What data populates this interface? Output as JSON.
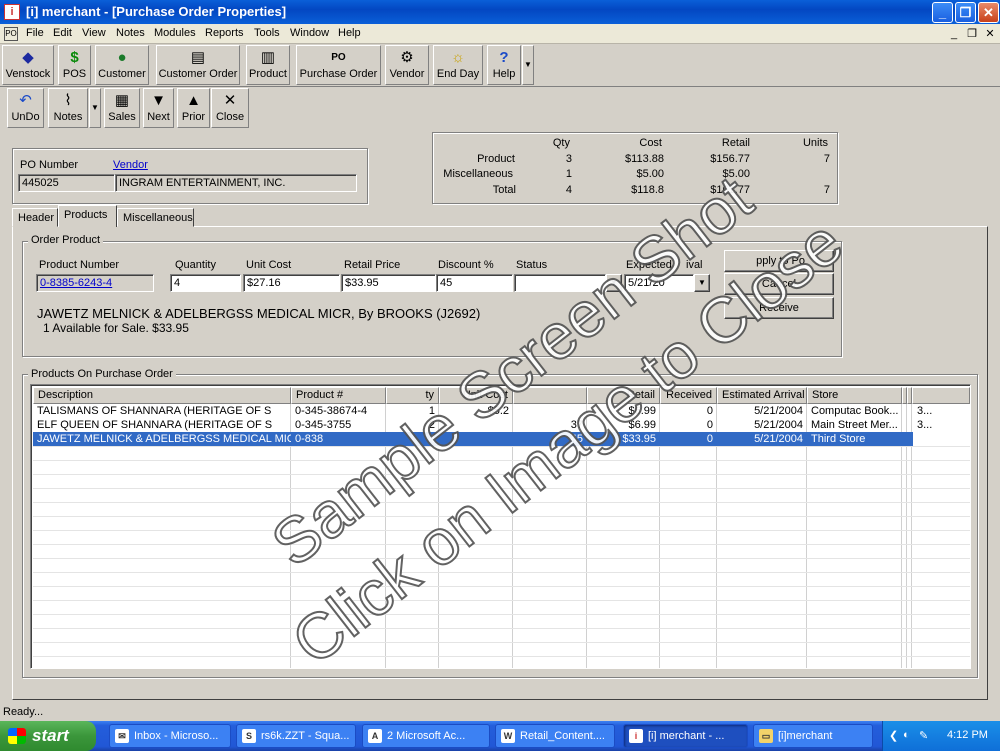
{
  "window": {
    "title": "[i] merchant - [Purchase Order Properties]",
    "app_icon": "i"
  },
  "menu": [
    "File",
    "Edit",
    "View",
    "Notes",
    "Modules",
    "Reports",
    "Tools",
    "Window",
    "Help"
  ],
  "main_toolbar": [
    {
      "label": "Venstock",
      "icon": "◆"
    },
    {
      "label": "POS",
      "icon": "$"
    },
    {
      "label": "Customer",
      "icon": "●"
    },
    {
      "label": "Customer Order",
      "icon": "▤"
    },
    {
      "label": "Product",
      "icon": "▥"
    },
    {
      "label": "Purchase Order",
      "icon": "PO"
    },
    {
      "label": "Vendor",
      "icon": "⚙"
    },
    {
      "label": "End Day",
      "icon": "☼"
    },
    {
      "label": "Help",
      "icon": "?"
    }
  ],
  "form_toolbar": [
    {
      "label": "UnDo",
      "icon": "↶"
    },
    {
      "label": "Notes",
      "icon": "⌇"
    },
    {
      "label": "Sales",
      "icon": "▦"
    },
    {
      "label": "Next",
      "icon": "▼"
    },
    {
      "label": "Prior",
      "icon": "▲"
    },
    {
      "label": "Close",
      "icon": "✕"
    }
  ],
  "po": {
    "po_number_label": "PO Number",
    "po_number": "445025",
    "vendor_label": "Vendor",
    "vendor": "INGRAM ENTERTAINMENT, INC."
  },
  "summary": {
    "headers": [
      "Qty",
      "Cost",
      "Retail",
      "Units"
    ],
    "rows": [
      {
        "label": "Product",
        "qty": "3",
        "cost": "$113.88",
        "retail": "$156.77",
        "units": "7"
      },
      {
        "label": "Miscellaneous",
        "qty": "1",
        "cost": "$5.00",
        "retail": "$5.00",
        "units": ""
      },
      {
        "label": "Total",
        "qty": "4",
        "cost": "$118.8",
        "retail": "$161.77",
        "units": "7"
      }
    ]
  },
  "tabs": [
    "Header",
    "Products",
    "Miscellaneous"
  ],
  "order_product": {
    "group_label": "Order Product",
    "product_number_label": "Product Number",
    "product_number": "0-8385-6243-4",
    "quantity_label": "Quantity",
    "quantity": "4",
    "unit_cost_label": "Unit Cost",
    "unit_cost": "$27.16",
    "retail_price_label": "Retail Price",
    "retail_price": "$33.95",
    "discount_label": "Discount %",
    "discount": "45",
    "status_label": "Status",
    "status": "",
    "expected_label": "Expected",
    "expected_label_2": "ival",
    "expected": "5/21/20",
    "description": "JAWETZ MELNICK & ADELBERGSS MEDICAL MICR, By  BROOKS  (J2692)",
    "availability": "1 Available for Sale. $33.95",
    "apply_button": "pply to Po",
    "cancel_button": "Cancel",
    "receive_button": "Receive"
  },
  "products_on_po": {
    "group_label": "Products On Purchase Order",
    "columns": [
      "Description",
      "Product #",
      "ty",
      "Unit Cost",
      "Retail",
      "Received",
      "Estimated Arrival",
      "Store"
    ],
    "rows": [
      {
        "description": "TALISMANS OF SHANNARA (HERITAGE OF S",
        "product": "0-345-38674-4",
        "qty": "1",
        "unit_cost": "$5.2",
        "discount": "",
        "retail": "$6.99",
        "received": "0",
        "arrival": "5/21/2004",
        "store": "Computac Book...",
        "extra": "3..."
      },
      {
        "description": "ELF QUEEN OF SHANNARA (HERITAGE OF S",
        "product": "0-345-3755",
        "qty": "2",
        "unit_cost": "",
        "discount": "37",
        "retail": "$6.99",
        "received": "0",
        "arrival": "5/21/2004",
        "store": "Main Street Mer...",
        "extra": "3..."
      },
      {
        "description": "JAWETZ MELNICK & ADELBERGSS MEDICAL MICR",
        "product": "0-838",
        "qty": "4",
        "unit_cost": "",
        "discount": "45",
        "retail": "$33.95",
        "received": "0",
        "arrival": "5/21/2004",
        "store": "Third Store",
        "extra": ""
      }
    ]
  },
  "watermark": {
    "line1": "Sample Screen Shot",
    "line2": "Click on Image to Close"
  },
  "status_bar": "Ready...",
  "taskbar": {
    "start": "start",
    "tasks": [
      {
        "label": "Inbox - Microso...",
        "icon": "✉"
      },
      {
        "label": "rs6k.ZZT - Squa...",
        "icon": "S"
      },
      {
        "label": "2 Microsoft Ac...",
        "icon": "A"
      },
      {
        "label": "Retail_Content....",
        "icon": "W"
      },
      {
        "label": "[i] merchant - ...",
        "icon": "i"
      },
      {
        "label": "[i]merchant",
        "icon": "▭"
      }
    ],
    "clock": "4:12 PM"
  }
}
